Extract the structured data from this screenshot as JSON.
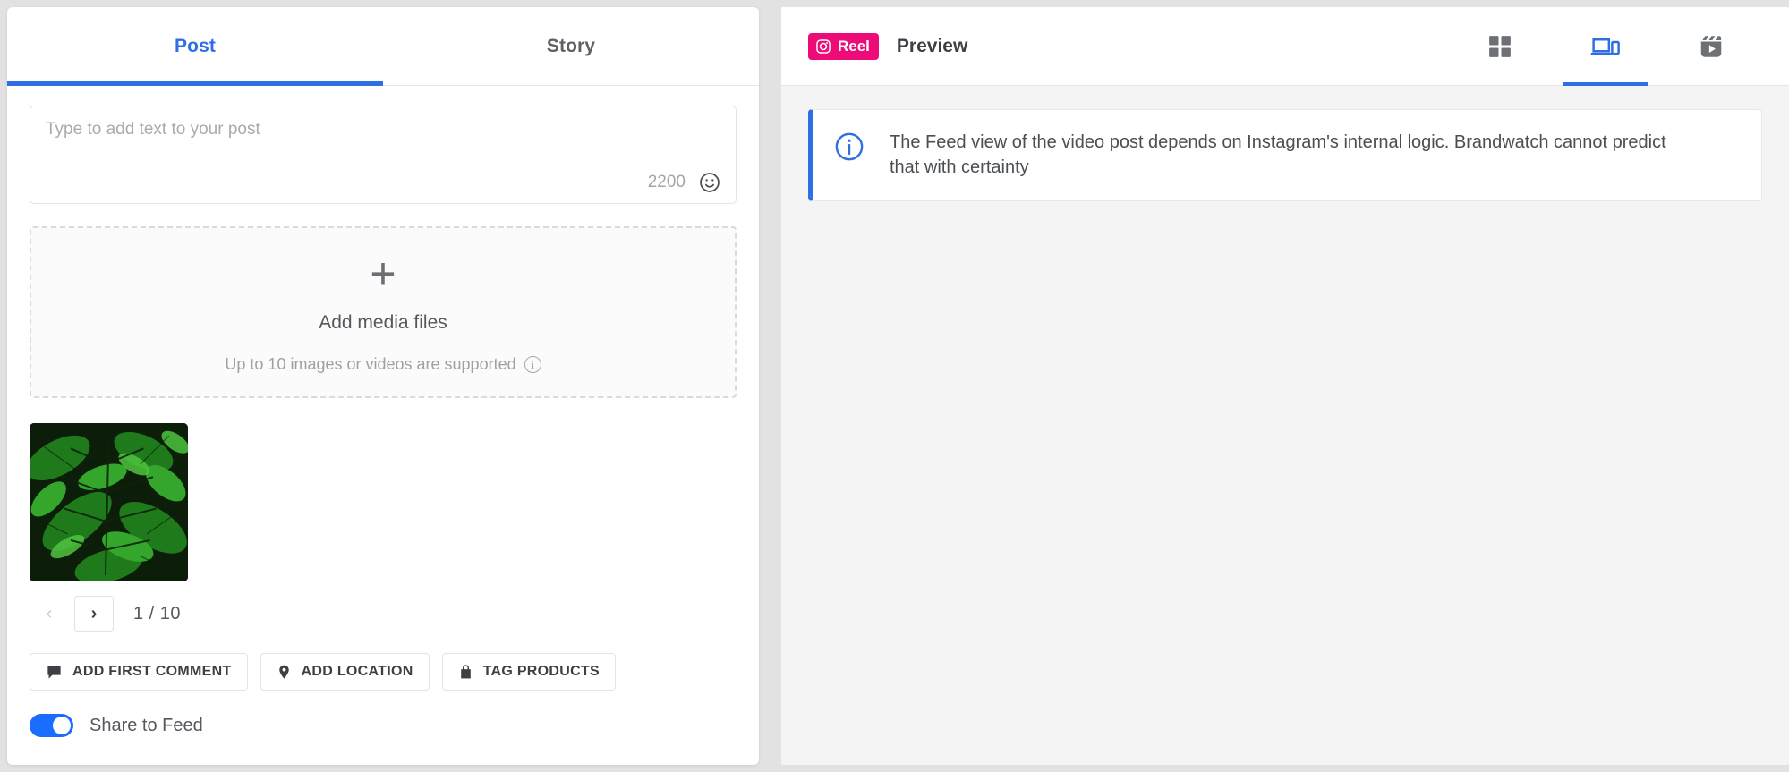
{
  "theme": {
    "accent_blue": "#2f6fe4",
    "toggle_blue": "#1a6dff",
    "instagram_pink": "#ec0b77",
    "page_background": "#e2e2e2",
    "panel_background": "#f4f4f5"
  },
  "left_panel": {
    "tabs": [
      {
        "label": "Post",
        "active": true
      },
      {
        "label": "Story",
        "active": false
      }
    ],
    "composer": {
      "placeholder": "Type to add text to your post",
      "value": "",
      "char_count": "2200",
      "emoji_icon": "smiley-face-icon"
    },
    "dropzone": {
      "plus_icon": "plus-icon",
      "title": "Add media files",
      "subtitle": "Up to 10 images or videos are supported",
      "info_icon": "info-icon",
      "info_glyph": "i"
    },
    "media": {
      "thumbnail_alt": "tropical green leaves photo",
      "prev_icon": "chevron-left-icon",
      "next_icon": "chevron-right-icon",
      "prev_enabled": false,
      "next_enabled": true,
      "counter": "1 / 10"
    },
    "action_buttons": [
      {
        "label": "ADD FIRST COMMENT",
        "icon": "comment-bubble-icon"
      },
      {
        "label": "ADD LOCATION",
        "icon": "location-pin-icon"
      },
      {
        "label": "TAG PRODUCTS",
        "icon": "shopping-bag-icon"
      }
    ],
    "share_toggle": {
      "label": "Share to Feed",
      "enabled": true
    }
  },
  "right_panel": {
    "badge": {
      "label": "Reel",
      "icon": "instagram-camera-icon"
    },
    "title": "Preview",
    "view_modes": [
      {
        "name": "grid-view",
        "icon": "grid-icon",
        "active": false
      },
      {
        "name": "devices-view",
        "icon": "devices-icon",
        "active": true
      },
      {
        "name": "reels-view",
        "icon": "reels-clapper-icon",
        "active": false
      }
    ],
    "notice": {
      "icon": "info-circle-icon",
      "text": "The Feed view of the video post depends on Instagram's internal logic. Brandwatch cannot predict that with certainty"
    }
  }
}
